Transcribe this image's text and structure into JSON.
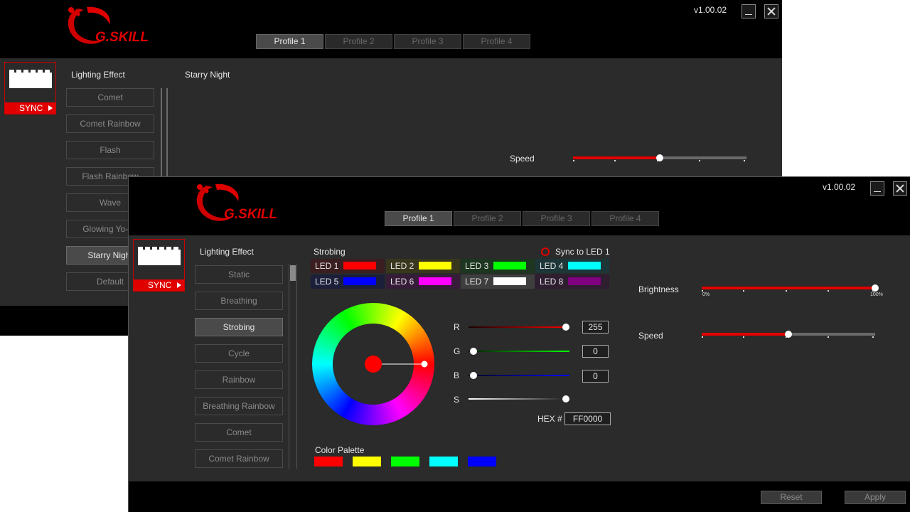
{
  "back_window": {
    "version": "v1.00.02",
    "tabs": [
      "Profile 1",
      "Profile 2",
      "Profile 3",
      "Profile 4"
    ],
    "sync_label": "SYNC",
    "lighting_heading": "Lighting Effect",
    "effect_title": "Starry Night",
    "effects": [
      "Comet",
      "Comet Rainbow",
      "Flash",
      "Flash Rainbow",
      "Wave",
      "Glowing Yo-Yo",
      "Starry Night",
      "Default"
    ],
    "active_effect": "Starry Night",
    "speed_label": "Speed",
    "speed_value": 0.5
  },
  "front_window": {
    "version": "v1.00.02",
    "tabs": [
      "Profile 1",
      "Profile 2",
      "Profile 3",
      "Profile 4"
    ],
    "sync_label": "SYNC",
    "lighting_heading": "Lighting Effect",
    "effect_title": "Strobing",
    "sync_to_led": "Sync to LED 1",
    "effects": [
      "Static",
      "Breathing",
      "Strobing",
      "Cycle",
      "Rainbow",
      "Breathing Rainbow",
      "Comet",
      "Comet Rainbow"
    ],
    "active_effect": "Strobing",
    "leds": [
      {
        "label": "LED 1",
        "color": "#ff0000",
        "bg": "#3a1e20"
      },
      {
        "label": "LED 2",
        "color": "#ffff00",
        "bg": "#38361c"
      },
      {
        "label": "LED 3",
        "color": "#00ff00",
        "bg": "#1d3620"
      },
      {
        "label": "LED 4",
        "color": "#00ffff",
        "bg": "#1d3638"
      },
      {
        "label": "LED 5",
        "color": "#0000ff",
        "bg": "#1c1f3a"
      },
      {
        "label": "LED 6",
        "color": "#ff00ff",
        "bg": "#361c38"
      },
      {
        "label": "LED 7",
        "color": "#ffffff",
        "bg": "#3e3e3e"
      },
      {
        "label": "LED 8",
        "color": "#800080",
        "bg": "#2e1e30"
      }
    ],
    "rgb": {
      "r_label": "R",
      "r_value": "255",
      "g_label": "G",
      "g_value": "0",
      "b_label": "B",
      "b_value": "0",
      "s_label": "S",
      "hex_label": "HEX #",
      "hex_value": "FF0000"
    },
    "palette_label": "Color Palette",
    "palette": [
      "#ff0000",
      "#ffff00",
      "#00ff00",
      "#00ffff",
      "#0000ff"
    ],
    "brightness_label": "Brightness",
    "brightness_min": "0%",
    "brightness_max": "100%",
    "brightness_value": 1.0,
    "speed_label": "Speed",
    "speed_value": 0.5,
    "reset_label": "Reset",
    "apply_label": "Apply"
  },
  "colors": {
    "accent": "#e00000",
    "panel": "#2a2b2a",
    "title_bar": "#000000"
  }
}
